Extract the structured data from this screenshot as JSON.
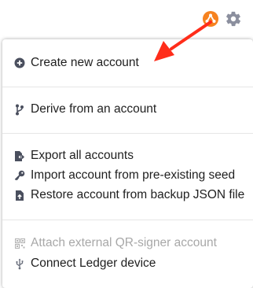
{
  "header": {
    "icons": [
      "add-account-icon",
      "gear-icon"
    ],
    "accent_color": "#f6821f"
  },
  "menu": {
    "create": "Create new account",
    "derive": "Derive from an account",
    "export": "Export all accounts",
    "import_seed": "Import account from pre-existing seed",
    "restore_json": "Restore account from backup JSON file",
    "attach_qr": "Attach external QR-signer account",
    "ledger": "Connect Ledger device"
  },
  "annotation": {
    "arrow_color": "#ff2d1a"
  }
}
